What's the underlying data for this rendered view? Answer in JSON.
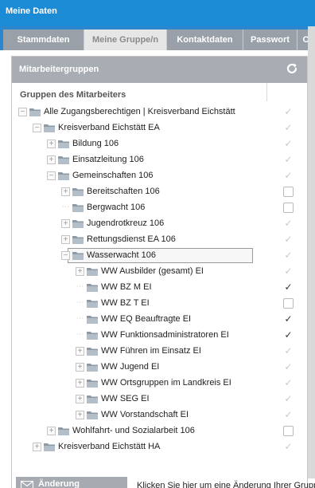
{
  "title": "Meine Daten",
  "tabs": [
    {
      "label": "Stammdaten"
    },
    {
      "label": "Meine Gruppe/n"
    },
    {
      "label": "Kontaktdaten"
    },
    {
      "label": "Passwort"
    },
    {
      "label": "C"
    }
  ],
  "panel": {
    "title": "Mitarbeitergruppen",
    "column_header": "Gruppen des Mitarbeiters"
  },
  "tree": [
    {
      "label": "Alle Zugangsberechtigen | Kreisverband Eichstätt",
      "level": 0,
      "expander": "minus",
      "check": "dim",
      "selected": false
    },
    {
      "label": "Kreisverband Eichstätt EA",
      "level": 1,
      "expander": "minus",
      "check": "dim",
      "selected": false
    },
    {
      "label": "Bildung 106",
      "level": 2,
      "expander": "plus",
      "check": "dim",
      "selected": false
    },
    {
      "label": "Einsatzleitung 106",
      "level": 2,
      "expander": "plus",
      "check": "dim",
      "selected": false
    },
    {
      "label": "Gemeinschaften 106",
      "level": 2,
      "expander": "minus",
      "check": "dim",
      "selected": false
    },
    {
      "label": "Bereitschaften 106",
      "level": 3,
      "expander": "plus",
      "check": "box",
      "selected": false
    },
    {
      "label": "Bergwacht 106",
      "level": 3,
      "expander": "none",
      "check": "box",
      "selected": false
    },
    {
      "label": "Jugendrotkreuz 106",
      "level": 3,
      "expander": "plus",
      "check": "dim",
      "selected": false
    },
    {
      "label": "Rettungsdienst EA 106",
      "level": 3,
      "expander": "plus",
      "check": "dim",
      "selected": false
    },
    {
      "label": "Wasserwacht 106",
      "level": 3,
      "expander": "minus",
      "check": "dim",
      "selected": true
    },
    {
      "label": "WW Ausbilder (gesamt) EI",
      "level": 4,
      "expander": "plus",
      "check": "dim",
      "selected": false
    },
    {
      "label": "WW BZ M EI",
      "level": 4,
      "expander": "none",
      "check": "dark",
      "selected": false
    },
    {
      "label": "WW BZ T EI",
      "level": 4,
      "expander": "none",
      "check": "box",
      "selected": false
    },
    {
      "label": "WW EQ Beauftragte EI",
      "level": 4,
      "expander": "none",
      "check": "dark",
      "selected": false
    },
    {
      "label": "WW Funktionsadministratoren EI",
      "level": 4,
      "expander": "none",
      "check": "dark",
      "selected": false
    },
    {
      "label": "WW Führen im Einsatz EI",
      "level": 4,
      "expander": "plus",
      "check": "dim",
      "selected": false
    },
    {
      "label": "WW Jugend EI",
      "level": 4,
      "expander": "plus",
      "check": "dim",
      "selected": false
    },
    {
      "label": "WW Ortsgruppen im Landkreis EI",
      "level": 4,
      "expander": "plus",
      "check": "dim",
      "selected": false
    },
    {
      "label": "WW SEG EI",
      "level": 4,
      "expander": "plus",
      "check": "dim",
      "selected": false
    },
    {
      "label": "WW Vorstandschaft EI",
      "level": 4,
      "expander": "plus",
      "check": "dim",
      "selected": false
    },
    {
      "label": "Wohlfahrt- und Sozialarbeit 106",
      "level": 2,
      "expander": "plus",
      "check": "box",
      "selected": false
    },
    {
      "label": "Kreisverband Eichstätt HA",
      "level": 1,
      "expander": "plus",
      "check": "dim",
      "selected": false
    }
  ],
  "footer": {
    "button_label": "Änderung beantragen",
    "hint": "Klicken Sie hier um eine Änderung Ihrer Grupp"
  },
  "colors": {
    "titlebar": "#1c8bd6",
    "tabbar": "#2a86cf",
    "inactive_tab": "#9aa0a7",
    "panel_header": "#a8adb3",
    "folder": "#8d9aa6"
  },
  "icons": {
    "refresh": "refresh-icon",
    "folder": "folder-icon",
    "checkmark": "checkmark-icon",
    "mail": "mail-icon"
  }
}
